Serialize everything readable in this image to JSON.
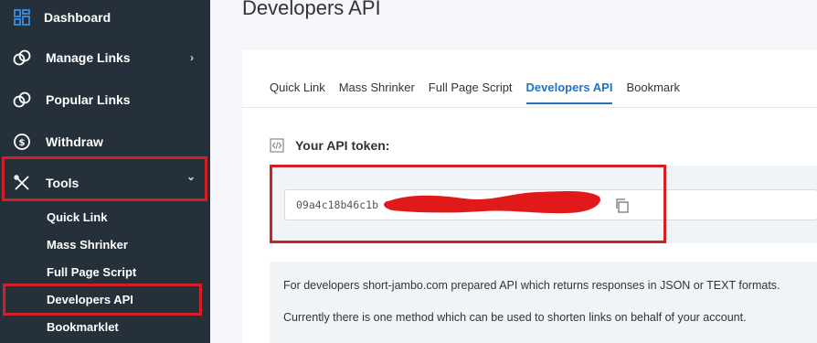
{
  "sidebar": {
    "items": [
      {
        "label": "Dashboard",
        "icon": "dashboard-icon"
      },
      {
        "label": "Manage Links",
        "icon": "link-icon",
        "chevron": "›"
      },
      {
        "label": "Popular Links",
        "icon": "link-icon"
      },
      {
        "label": "Withdraw",
        "icon": "coins-icon"
      },
      {
        "label": "Tools",
        "icon": "tools-icon",
        "chevron": "⌄"
      }
    ],
    "sub_items": [
      {
        "label": "Quick Link"
      },
      {
        "label": "Mass Shrinker"
      },
      {
        "label": "Full Page Script"
      },
      {
        "label": "Developers API"
      },
      {
        "label": "Bookmarklet"
      }
    ]
  },
  "main": {
    "title": "Developers API",
    "tabs": [
      {
        "label": "Quick Link",
        "active": false
      },
      {
        "label": "Mass Shrinker",
        "active": false
      },
      {
        "label": "Full Page Script",
        "active": false
      },
      {
        "label": "Developers API",
        "active": true
      },
      {
        "label": "Bookmark",
        "active": false
      }
    ],
    "token_heading": "Your API token:",
    "token_value": "09a4c18b46c1b",
    "info_lines": [
      "For developers short-jambo.com prepared API which returns responses in JSON or TEXT formats.",
      "Currently there is one method which can be used to shorten links on behalf of your account."
    ]
  },
  "colors": {
    "sidebar_bg": "#26303b",
    "accent": "#1f75c5",
    "highlight_red": "#d32027"
  }
}
